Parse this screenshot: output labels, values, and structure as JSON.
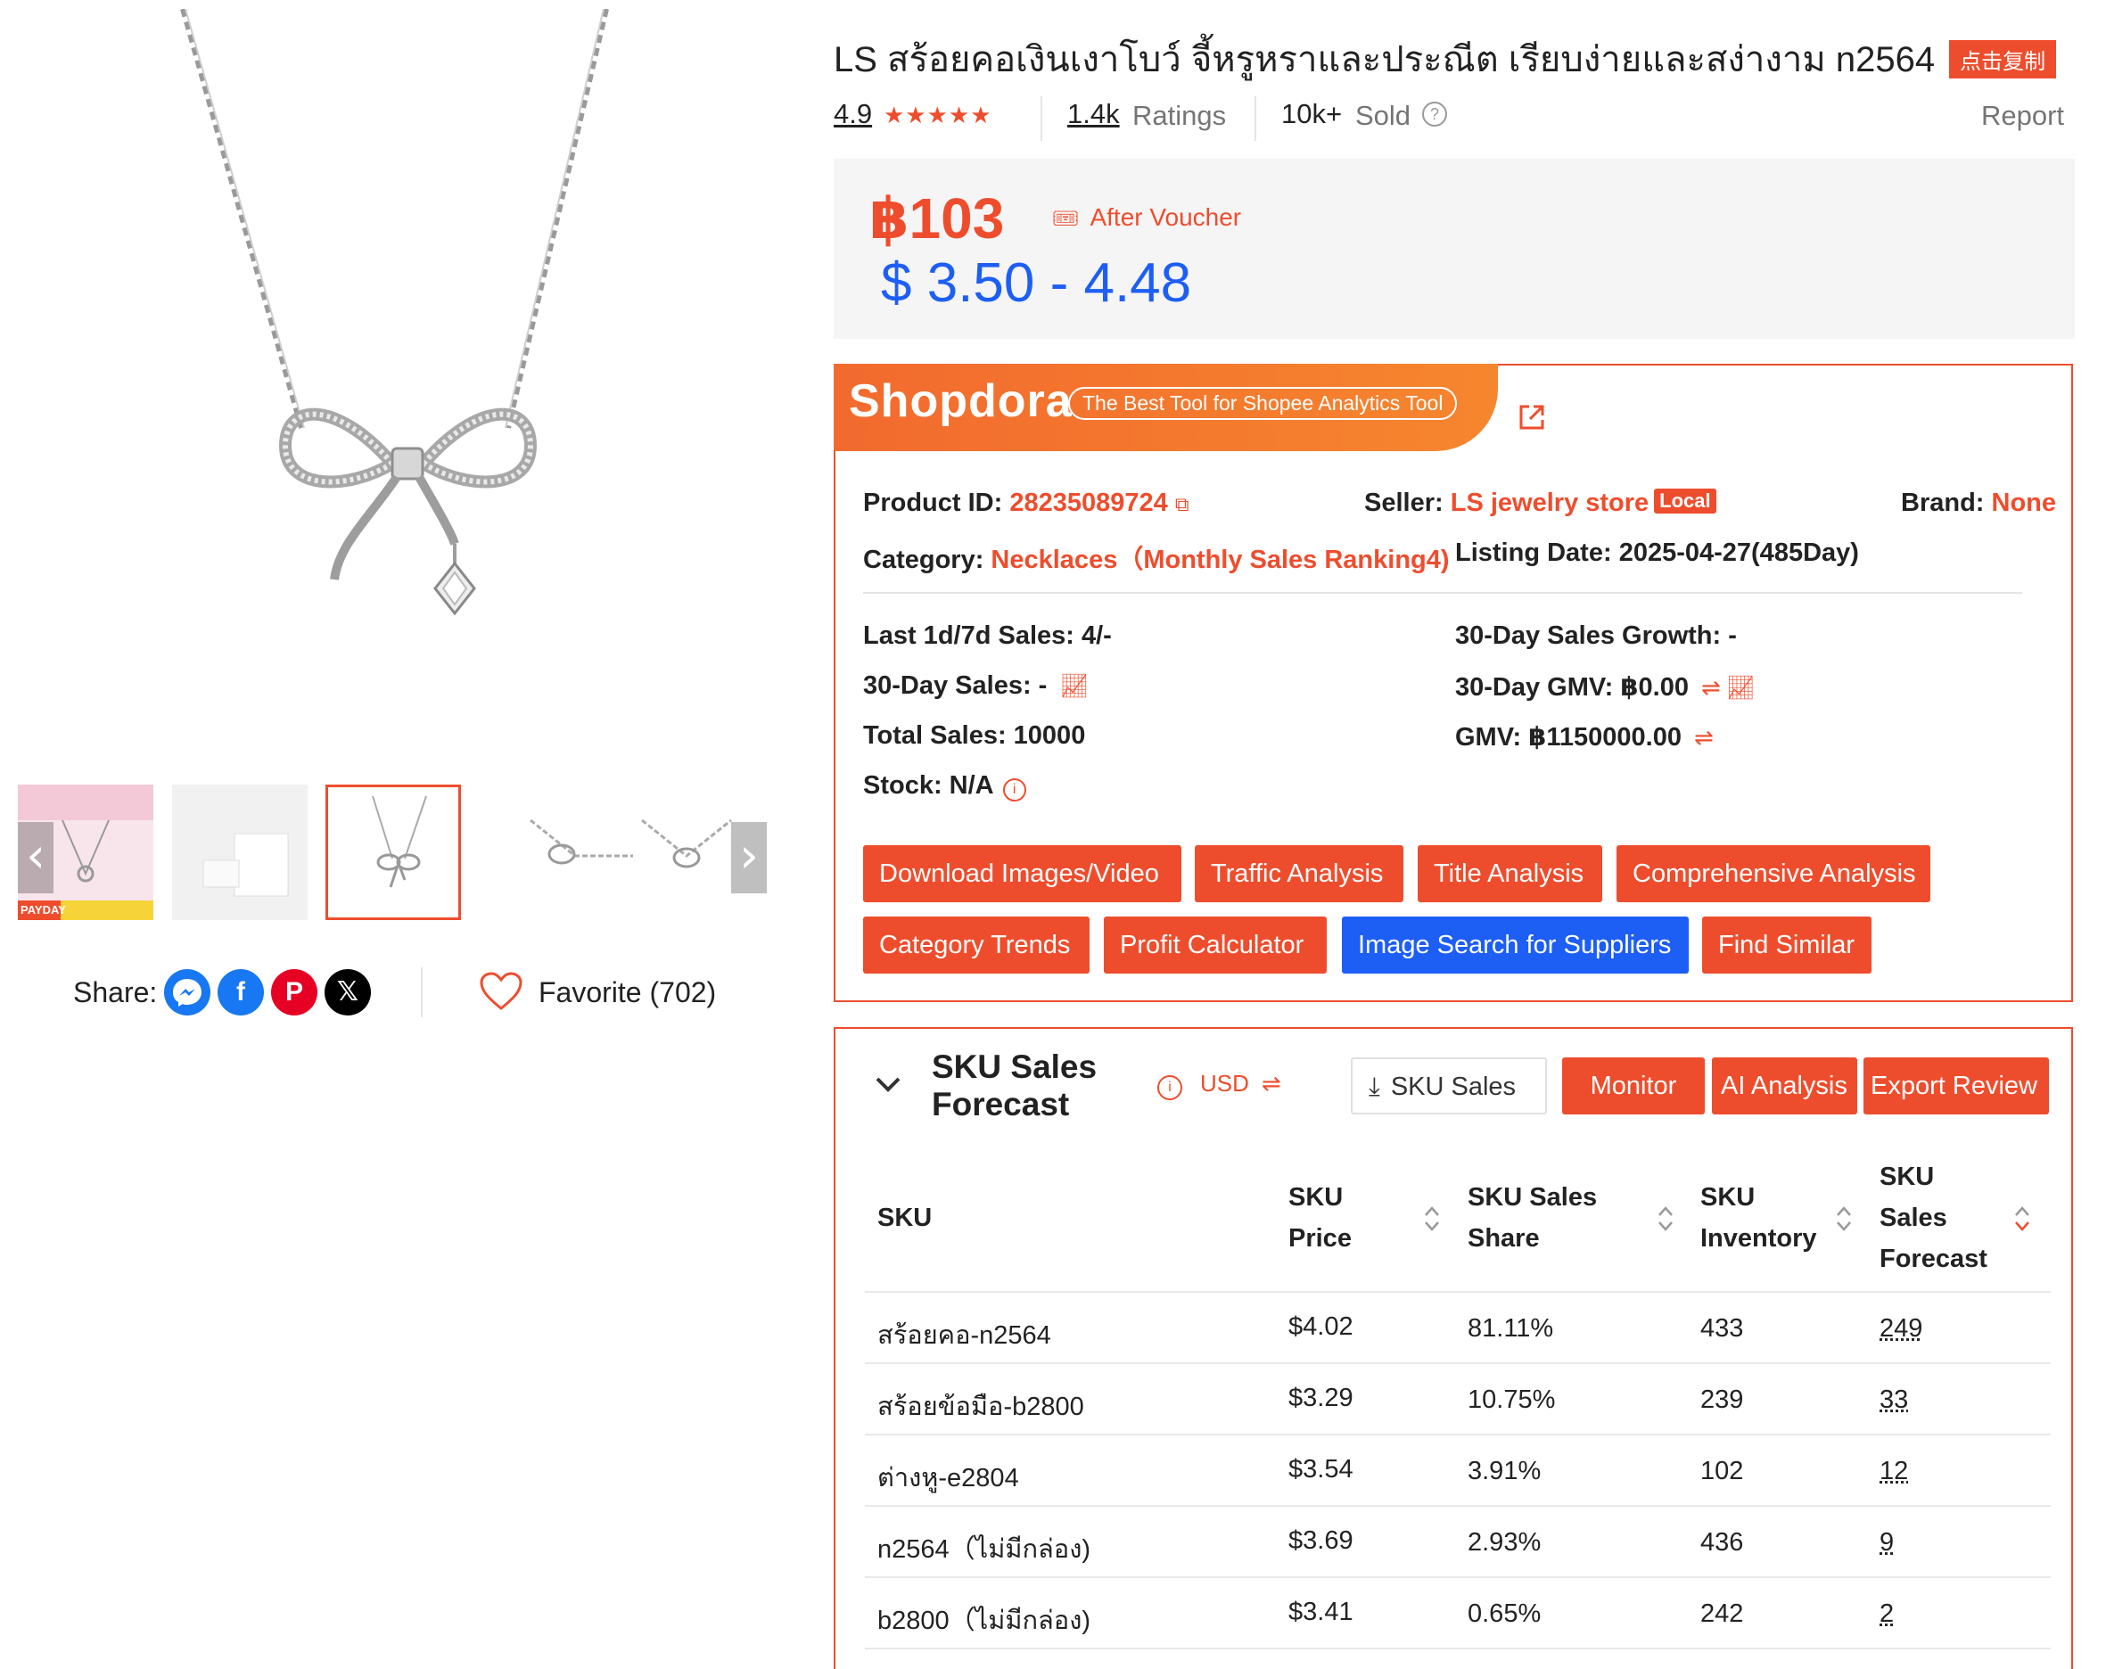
{
  "product": {
    "title": "LS สร้อยคอเงินเงาโบว์ จี้หรูหราและประณีต เรียบง่ายและสง่างาม n2564",
    "copy_badge": "点击复制",
    "rating_value": "4.9",
    "ratings_count": "1.4k",
    "ratings_label": "Ratings",
    "sold_count": "10k+",
    "sold_label": "Sold",
    "report_label": "Report"
  },
  "price": {
    "voucher_price": "฿103",
    "after_voucher_label": "After Voucher",
    "usd_range": "$ 3.50 - 4.48"
  },
  "gallery": {
    "thumbnail_text": [
      "PAYDAY"
    ],
    "share_label": "Share:",
    "favorite_label": "Favorite (702)",
    "social_icons": [
      "messenger-icon",
      "facebook-icon",
      "pinterest-icon",
      "x-icon"
    ]
  },
  "shopdora": {
    "logo": "Shopdora",
    "tagline": "The Best Tool for Shopee Analytics Tool",
    "product_id_label": "Product ID:",
    "product_id": "28235089724",
    "seller_label": "Seller:",
    "seller": "LS jewelry store",
    "local_badge": "Local",
    "brand_label": "Brand:",
    "brand": "None",
    "category_label": "Category:",
    "category": "Necklaces（Monthly Sales Ranking4)",
    "listing_label": "Listing Date:",
    "listing_value": "2025-04-27(485Day)",
    "stats": {
      "last_sales": "Last 1d/7d Sales: 4/-",
      "sales_30": "30-Day Sales: -",
      "total_sales": "Total Sales: 10000",
      "stock": "Stock: N/A",
      "growth_30": "30-Day Sales Growth: -",
      "gmv_30": "30-Day GMV: ฿0.00",
      "gmv": "GMV: ฿1150000.00"
    },
    "buttons": {
      "download": "Download Images/Video",
      "traffic": "Traffic Analysis",
      "title_analysis": "Title Analysis",
      "comprehensive": "Comprehensive Analysis",
      "category_trends": "Category Trends",
      "profit": "Profit Calculator",
      "image_search": "Image Search for Suppliers",
      "find_similar": "Find Similar"
    }
  },
  "sku": {
    "title": "SKU Sales Forecast",
    "currency": "USD",
    "buttons": {
      "export_sku": "SKU Sales",
      "monitor": "Monitor",
      "ai": "AI Analysis",
      "export_review": "Export Review"
    },
    "headers": {
      "sku": "SKU",
      "price": "SKU Price",
      "share": "SKU Sales Share",
      "inventory": "SKU Inventory",
      "forecast": "SKU Sales Forecast"
    },
    "rows": [
      {
        "sku": "สร้อยคอ-n2564",
        "price": "$4.02",
        "share": "81.11%",
        "inventory": "433",
        "forecast": "249"
      },
      {
        "sku": "สร้อยข้อมือ-b2800",
        "price": "$3.29",
        "share": "10.75%",
        "inventory": "239",
        "forecast": "33"
      },
      {
        "sku": "ต่างหู-e2804",
        "price": "$3.54",
        "share": "3.91%",
        "inventory": "102",
        "forecast": "12"
      },
      {
        "sku": "n2564（ไม่มีกล่อง)",
        "price": "$3.69",
        "share": "2.93%",
        "inventory": "436",
        "forecast": "9"
      },
      {
        "sku": "b2800（ไม่มีกล่อง)",
        "price": "$3.41",
        "share": "0.65%",
        "inventory": "242",
        "forecast": "2"
      }
    ]
  },
  "colors": {
    "accent": "#ee4d2d",
    "usd_price": "#1d5ef5",
    "star": "#ee4d2d"
  }
}
